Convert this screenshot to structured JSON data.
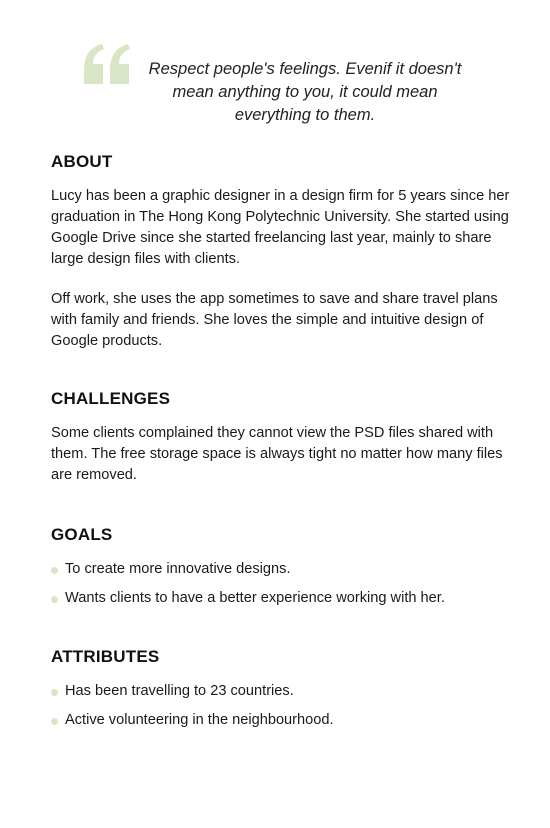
{
  "theme": {
    "accent": "#d9e6c6"
  },
  "quote": {
    "icon": "quote-icon",
    "text": "Respect people's feelings. Evenif it doesn't mean anything to you, it could mean everything to them."
  },
  "about": {
    "heading": "ABOUT",
    "paragraphs": [
      "Lucy has been a graphic designer in a design firm for 5 years since her graduation in The Hong Kong Polytechnic University. She started using Google Drive since she started freelancing last year, mainly to share large design files with clients.",
      "Off work, she uses the app sometimes to save and share travel plans with family and friends. She loves the simple and intuitive design of Google products."
    ]
  },
  "challenges": {
    "heading": "CHALLENGES",
    "text": "Some clients complained they cannot view the PSD files shared with them. The free storage space is always tight no matter how many files are removed."
  },
  "goals": {
    "heading": "GOALS",
    "items": [
      "To create more innovative designs.",
      "Wants clients to have a better experience working with her."
    ]
  },
  "attributes": {
    "heading": "ATTRIBUTES",
    "items": [
      "Has been travelling to 23 countries.",
      "Active volunteering in the neighbourhood."
    ]
  }
}
